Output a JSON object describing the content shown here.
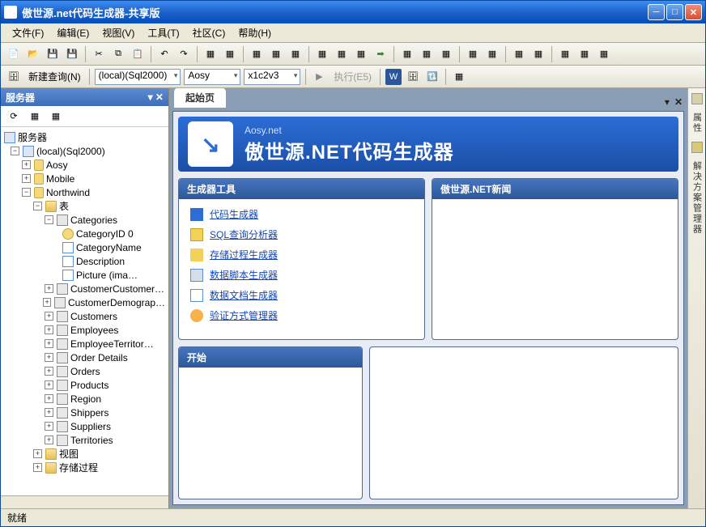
{
  "window": {
    "title": "傲世源.net代码生成器-共享版"
  },
  "menu": {
    "file": "文件(F)",
    "edit": "编辑(E)",
    "view": "视图(V)",
    "tools": "工具(T)",
    "community": "社区(C)",
    "help": "帮助(H)"
  },
  "toolbar2": {
    "new_query": "新建查询(N)",
    "server": "(local)(Sql2000)",
    "user": "Aosy",
    "pass": "x1c2v3",
    "execute": "执行(E5)"
  },
  "side": {
    "title": "服务器",
    "root": "服务器",
    "server": "(local)(Sql2000)",
    "db": {
      "aosy": "Aosy",
      "mobile": "Mobile",
      "northwind": "Northwind"
    },
    "tables_node": "表",
    "table_categories": "Categories",
    "cols": {
      "id": "CategoryID 0",
      "name": "CategoryName",
      "desc": "Description",
      "pic": "Picture (ima…"
    },
    "tables": [
      "CustomerCustomer…",
      "CustomerDemograp…",
      "Customers",
      "Employees",
      "EmployeeTerritor…",
      "Order Details",
      "Orders",
      "Products",
      "Region",
      "Shippers",
      "Suppliers",
      "Territories"
    ],
    "views": "视图",
    "procs": "存储过程"
  },
  "tabs": {
    "start": "起始页"
  },
  "banner": {
    "sub": "Aosy.net",
    "title": "傲世源.NET代码生成器"
  },
  "cards": {
    "tools": "生成器工具",
    "news": "傲世源.NET新闻",
    "start": "开始"
  },
  "links": {
    "code_gen": "代码生成器",
    "sql_analyzer": "SQL查询分析器",
    "proc_gen": "存储过程生成器",
    "script_gen": "数据脚本生成器",
    "doc_gen": "数据文档生成器",
    "auth_mgr": "验证方式管理器"
  },
  "rside": {
    "props": "属性",
    "solution": "解决方案管理器"
  },
  "status": {
    "ready": "就绪"
  }
}
